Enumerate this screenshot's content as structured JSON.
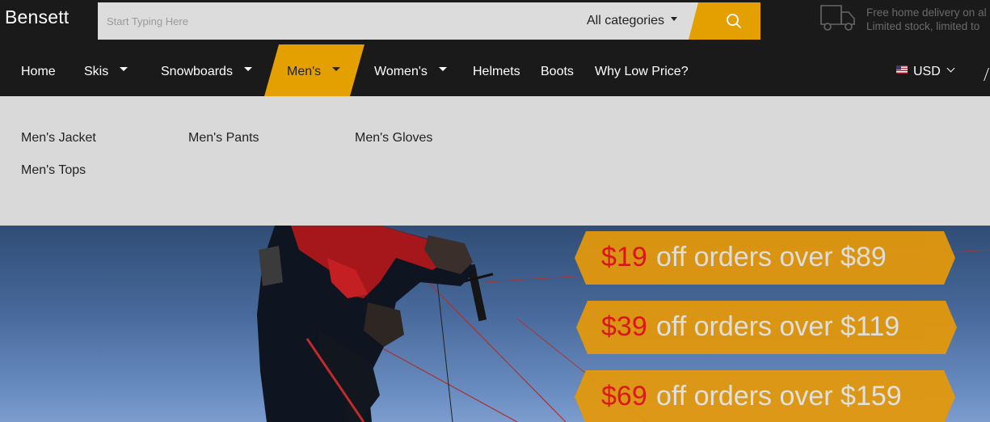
{
  "header": {
    "logo": "Bensett",
    "search": {
      "placeholder": "Start Typing Here",
      "category_selected": "All categories"
    },
    "delivery": {
      "line1": "Free home delivery on al",
      "line2": "Limited stock, limited to"
    }
  },
  "nav": {
    "items": [
      {
        "label": "Home"
      },
      {
        "label": "Skis"
      },
      {
        "label": "Snowboards"
      },
      {
        "label": "Men's"
      },
      {
        "label": "Women's"
      },
      {
        "label": "Helmets"
      },
      {
        "label": "Boots"
      },
      {
        "label": "Why Low Price?"
      }
    ],
    "active": "Men's",
    "currency": "USD"
  },
  "mens_menu": {
    "links": [
      {
        "label": "Men's Jacket"
      },
      {
        "label": "Men's Pants"
      },
      {
        "label": "Men's Gloves"
      },
      {
        "label": "Men's Tops"
      }
    ]
  },
  "promos": [
    {
      "amount": "$19",
      "text": " off orders over $89"
    },
    {
      "amount": "$39",
      "text": " off orders over $119"
    },
    {
      "amount": "$69",
      "text": " off orders over $159"
    }
  ],
  "colors": {
    "brand_accent": "#e3a000",
    "bar_bg": "#1a1a1a",
    "dropdown_bg": "#d9d9d9",
    "promo_bg": "#e3980b",
    "promo_amount": "#e4110f"
  },
  "icons": {
    "search": "search-icon",
    "delivery": "delivery-truck-icon",
    "dropdown": "caret-down-icon",
    "currency_chevron": "chevron-down-icon",
    "flag": "us-flag-icon"
  }
}
